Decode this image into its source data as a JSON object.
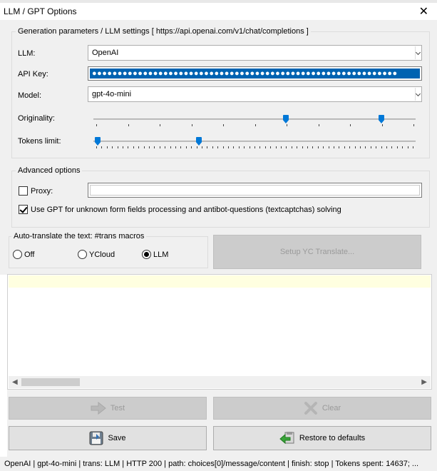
{
  "window": {
    "title": "LLM / GPT Options",
    "close_glyph": "✕"
  },
  "generation": {
    "group_title": "Generation parameters / LLM settings  [ https://api.openai.com/v1/chat/completions ]",
    "llm_label": "LLM:",
    "llm_value": "OpenAI",
    "api_key_label": "API Key:",
    "api_key_mask": "●●●●●●●●●●●●●●●●●●●●●●●●●●●●●●●●●●●●●●●●●●●●●●●●●●●●●●●●●●●●",
    "model_label": "Model:",
    "model_value": "gpt-4o-mini",
    "originality_label": "Originality:",
    "tokens_label": "Tokens limit:"
  },
  "advanced": {
    "group_title": "Advanced options",
    "proxy_label": "Proxy:",
    "proxy_value": "",
    "proxy_checked": false,
    "use_gpt_label": "Use GPT for unknown form fields processing and antibot-questions (textcaptchas) solving",
    "use_gpt_checked": true
  },
  "autotranslate": {
    "group_title": "Auto-translate the text: #trans macros",
    "options": [
      {
        "label": "Off",
        "checked": false
      },
      {
        "label": "YCloud",
        "checked": false
      },
      {
        "label": "LLM",
        "checked": true
      }
    ],
    "setup_button": "Setup YC Translate..."
  },
  "buttons": {
    "test": "Test",
    "clear": "Clear",
    "save": "Save",
    "restore": "Restore to defaults"
  },
  "status": {
    "text": "OpenAI | gpt-4o-mini | trans: LLM | HTTP 200 | path: choices[0]/message/content | finish: stop | Tokens spent: 14637; ..."
  },
  "colors": {
    "accent": "#0078d7",
    "selection": "#0063b1",
    "log_highlight": "#ffffe0",
    "save_icon": "#607080",
    "restore_arrow": "#3aa33a"
  },
  "icons": {
    "test": "arrow-right-icon",
    "clear": "x-clear-icon",
    "save": "save-disk-icon",
    "restore": "restore-arrow-icon"
  }
}
